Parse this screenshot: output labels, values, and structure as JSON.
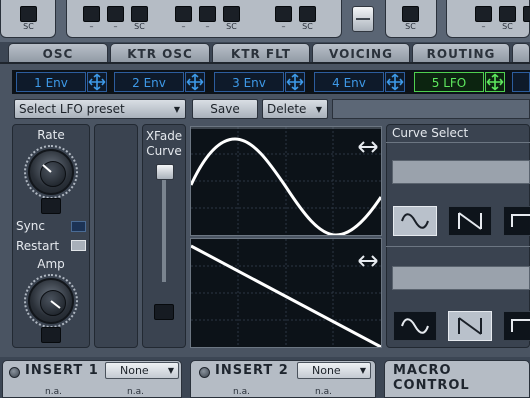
{
  "top": {
    "sc_labels": [
      "SC",
      "–",
      "SC",
      "–",
      "SC",
      "–",
      "SC",
      "SC",
      "–",
      "SC",
      "–"
    ]
  },
  "tabs": [
    "OSC",
    "KTR OSC",
    "KTR FLT",
    "VOICING",
    "ROUTING"
  ],
  "env_buttons": [
    "1 Env",
    "2 Env",
    "3 Env",
    "4 Env",
    "5 LFO"
  ],
  "preset": {
    "select_label": "Select LFO preset",
    "save_label": "Save",
    "delete_label": "Delete"
  },
  "lfo": {
    "rate_label": "Rate",
    "sync_label": "Sync",
    "restart_label": "Restart",
    "amp_label": "Amp",
    "xfade_label": "XFade",
    "curve_label": "Curve"
  },
  "curve_select": {
    "title": "Curve Select"
  },
  "bottom": {
    "insert1": {
      "title": "INSERT 1",
      "value": "None",
      "na1": "n.a.",
      "na2": "n.a."
    },
    "insert2": {
      "title": "INSERT 2",
      "value": "None",
      "na1": "n.a.",
      "na2": "n.a."
    },
    "macro": {
      "title": "MACRO CONTROL"
    }
  },
  "colors": {
    "env_blue": "#3e9ae8",
    "lfo_green": "#5ee85e",
    "curve_white": "#ffffff"
  }
}
